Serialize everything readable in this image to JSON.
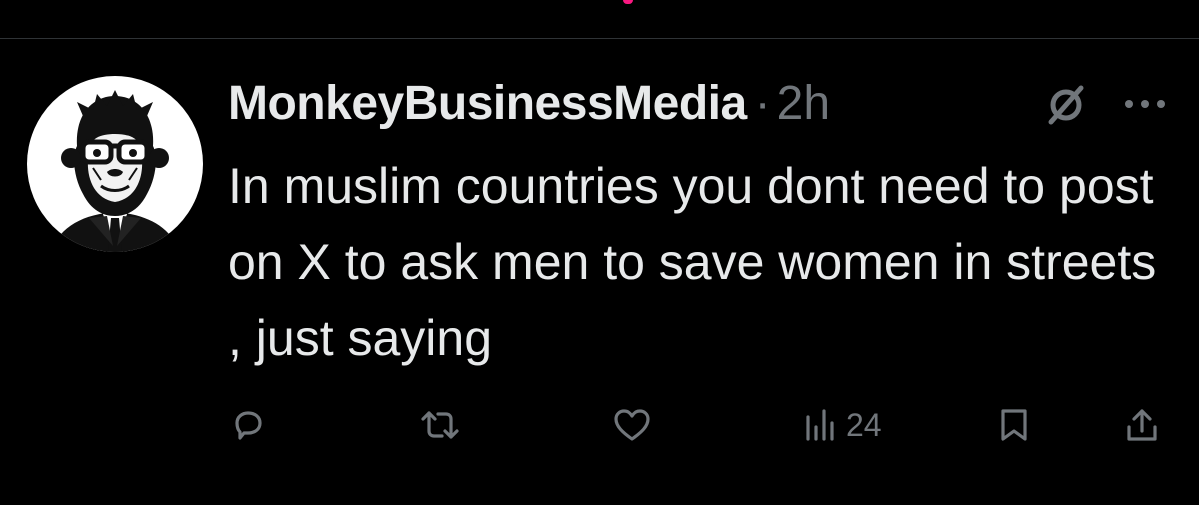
{
  "tweet": {
    "display_name": "MonkeyBusinessMedia",
    "separator": "·",
    "time": "2h",
    "text": "In muslim countries you dont need to post on X to ask men to save women in streets , just saying",
    "avatar_icon": "monkey-in-suit-sunglasses",
    "header_icons": [
      "grok-icon",
      "more-icon"
    ]
  },
  "actions": {
    "reply_icon": "reply-icon",
    "retweet_icon": "retweet-icon",
    "like_icon": "heart-icon",
    "views_icon": "views-icon",
    "views_count": "24",
    "bookmark_icon": "bookmark-icon",
    "share_icon": "share-icon"
  },
  "colors": {
    "background": "#000000",
    "text_primary": "#e7e9ea",
    "text_secondary": "#71767b",
    "divider": "#2f3336",
    "accent": "#f91880"
  }
}
